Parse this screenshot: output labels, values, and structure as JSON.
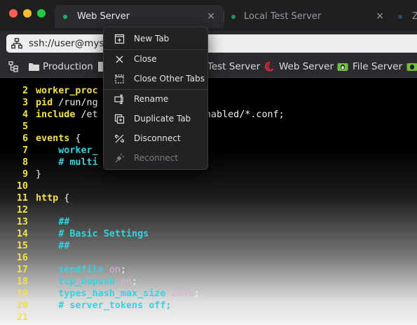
{
  "tabs": [
    {
      "label": "Web Server",
      "active": true,
      "close": "×",
      "dot_color": "#1fae6a"
    },
    {
      "label": "Local Test Server",
      "active": false,
      "close": "×",
      "dot_color": "#1d9a5e"
    },
    {
      "label": "Z",
      "active": false,
      "dot_color": "#274c6a"
    }
  ],
  "address": {
    "value": "ssh://user@myserv",
    "icon": "network-icon"
  },
  "bookmarks": [
    {
      "label": "Production",
      "icon": "folder-icon"
    },
    {
      "label": "Test Server",
      "icon": "server-icon"
    },
    {
      "label": "Web Server",
      "icon": "debian-icon"
    },
    {
      "label": "File Server",
      "icon": "tux-icon"
    }
  ],
  "context_menu": {
    "items": [
      {
        "label": "New Tab",
        "icon": "new-tab-icon",
        "enabled": true
      },
      {
        "label": "Close",
        "icon": "close-icon",
        "enabled": true
      },
      {
        "label": "Close Other Tabs",
        "icon": "close-others-icon",
        "enabled": true
      },
      {
        "label": "Rename",
        "icon": "rename-icon",
        "enabled": true
      },
      {
        "label": "Duplicate Tab",
        "icon": "duplicate-icon",
        "enabled": true
      },
      {
        "label": "Disconnect",
        "icon": "disconnect-icon",
        "enabled": true
      },
      {
        "label": "Reconnect",
        "icon": "reconnect-icon",
        "enabled": false
      }
    ]
  },
  "editor": {
    "lines": [
      {
        "n": "2",
        "parts": [
          {
            "t": "worker_proc",
            "c": "kw"
          }
        ]
      },
      {
        "n": "3",
        "parts": [
          {
            "t": "pid",
            "c": "kw"
          },
          {
            "t": " /run/ng",
            "c": "plain"
          }
        ]
      },
      {
        "n": "4",
        "parts": [
          {
            "t": "include",
            "c": "kw"
          },
          {
            "t": " /et",
            "c": "plain"
          },
          {
            "t": "                  ",
            "c": "plain"
          },
          {
            "t": "enabled/*.conf;",
            "c": "plain"
          }
        ]
      },
      {
        "n": "5",
        "parts": []
      },
      {
        "n": "6",
        "parts": [
          {
            "t": "events",
            "c": "kw"
          },
          {
            "t": " {",
            "c": "plain"
          }
        ]
      },
      {
        "n": "7",
        "parts": [
          {
            "t": "    worker_",
            "c": "dir"
          }
        ]
      },
      {
        "n": "8",
        "parts": [
          {
            "t": "    # multi",
            "c": "cmt"
          }
        ]
      },
      {
        "n": "9",
        "parts": [
          {
            "t": "}",
            "c": "plain"
          }
        ]
      },
      {
        "n": "10",
        "parts": []
      },
      {
        "n": "11",
        "parts": [
          {
            "t": "http",
            "c": "kw"
          },
          {
            "t": " {",
            "c": "plain"
          }
        ]
      },
      {
        "n": "12",
        "parts": []
      },
      {
        "n": "13",
        "parts": [
          {
            "t": "    ##",
            "c": "cmt"
          }
        ]
      },
      {
        "n": "14",
        "parts": [
          {
            "t": "    # Basic Settings",
            "c": "cmt"
          }
        ]
      },
      {
        "n": "15",
        "parts": [
          {
            "t": "    ##",
            "c": "cmt"
          }
        ]
      },
      {
        "n": "16",
        "parts": []
      },
      {
        "n": "17",
        "parts": [
          {
            "t": "    sendfile",
            "c": "dir"
          },
          {
            "t": " ",
            "c": "plain"
          },
          {
            "t": "on",
            "c": "num"
          },
          {
            "t": ";",
            "c": "plain"
          }
        ]
      },
      {
        "n": "18",
        "parts": [
          {
            "t": "    tcp_nopush",
            "c": "dir"
          },
          {
            "t": " ",
            "c": "plain"
          },
          {
            "t": "on",
            "c": "num"
          },
          {
            "t": ";",
            "c": "plain"
          }
        ]
      },
      {
        "n": "19",
        "parts": [
          {
            "t": "    types_hash_max_size",
            "c": "dir"
          },
          {
            "t": " ",
            "c": "plain"
          },
          {
            "t": "2048",
            "c": "num"
          },
          {
            "t": ";",
            "c": "plain"
          }
        ]
      },
      {
        "n": "20",
        "parts": [
          {
            "t": "    # server_tokens off;",
            "c": "cmt"
          }
        ]
      },
      {
        "n": "21",
        "parts": []
      }
    ]
  },
  "colors": {
    "keyword": "#f2e14a",
    "directive": "#35d3e0",
    "value": "#d9b0d4",
    "plain": "#f1f1f1",
    "accent_green": "#1fae6a",
    "debian_red": "#d7263d",
    "tux_green": "#6fbf3a"
  }
}
